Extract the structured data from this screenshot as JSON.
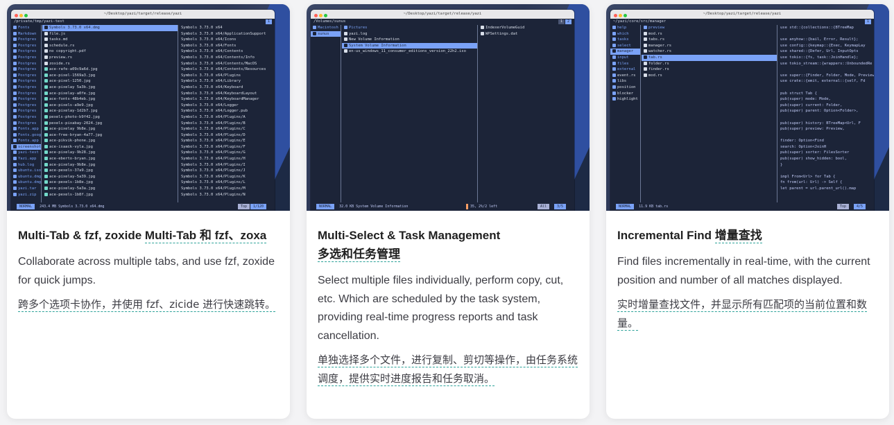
{
  "cards": [
    {
      "title": "Multi-Tab & fzf, zoxide",
      "title_cn": "Multi-Tab 和 fzf、zoxa",
      "description": "Collaborate across multiple tabs, and use fzf, zoxide for quick jumps.",
      "description_cn": "跨多个选项卡协作，并使用 fzf、zicide 进行快速跳转。",
      "terminal": {
        "window_title": "~/Desktop/yazi/target/release/yazi",
        "path": "/private/tmp/yazi-test",
        "tab_indicator": "1",
        "parent_rows": [
          "Fonts",
          "Markdown",
          "Postgres",
          "Postgres",
          "Postgres",
          "Postgres",
          "Postgres",
          "Postgres",
          "Postgres",
          "Postgres",
          "Postgres",
          "Postgres",
          "Postgres",
          "Postgres",
          "Postgres",
          "Postgres",
          "Postgres",
          "Fonts.app",
          "Fonts.goog",
          "Fonts.app",
          "screenshot",
          "yazi-test",
          "Yazi.app",
          "hub.log",
          "ubuntu.iso",
          "ubuntu.dmg",
          "ubuntu.dmg",
          "yazi.tar",
          "yazi.zip"
        ],
        "current_rows": [
          "Symbols 3.73.0 x64.dmg",
          "file.js",
          "tasks.md",
          "schedule.rs",
          "no copyright.pdf",
          "preview.rs",
          "zoxide.rs",
          "ace-rafe-a09c9a6d.jpg",
          "ace-pixel-1569a3.jpg",
          "ace-pixel-1250.jpg",
          "ace-pixelay 5a3b.jpg",
          "ace-pixelay-a0fe.jpg",
          "ace-fonts-48b4eb.jpg",
          "ace-pixels-a9e9.jpg",
          "ace-pixelay-1d2b7.jpg",
          "pexels-photo-b9f42.jpg",
          "pexels-pixabay-2024.jpg",
          "ace-pixelay 9b8e.jpg",
          "ace-free-bryan-4a77.jpg",
          "ace-pikvik-phone.jpg",
          "ace-isaack-vyla.jpg",
          "ace-pixelay-9b28.jpg",
          "ace-eberto-bryan.jpg",
          "ace-pixelay-9b8e.jpg",
          "ace-pexels-37a9.jpg",
          "ace-pixelay-5a39.jpg",
          "ace-pexels-1b8e.jpg",
          "ace-pixelay-5a3a.jpg",
          "ace-pexels-1b8f.jpg"
        ],
        "preview_rows": [
          "Symbols 3.73.0 x64",
          "Symbols 3.73.0 x64/ApplicationSupport",
          "Symbols 3.73.0 x64/Icons",
          "Symbols 3.73.0 x64/Fonts",
          "Symbols 3.73.0 x64/Contents",
          "Symbols 3.73.0 x64/Contents/Info",
          "Symbols 3.73.0 x64/Contents/MacOS",
          "Symbols 3.73.0 x64/Contents/Resources",
          "Symbols 3.73.0 x64/Plugins",
          "Symbols 3.73.0 x64/Library",
          "Symbols 3.73.0 x64/Keyboard",
          "Symbols 3.73.0 x64/KeyboardLayout",
          "Symbols 3.73.0 x64/KeyboardManager",
          "Symbols 3.73.0 x64/Logger",
          "Symbols 3.73.0 x64/Logger.pub",
          "Symbols 3.73.0 x64/Plugins/A",
          "Symbols 3.73.0 x64/Plugins/B",
          "Symbols 3.73.0 x64/Plugins/C",
          "Symbols 3.73.0 x64/Plugins/D",
          "Symbols 3.73.0 x64/Plugins/E",
          "Symbols 3.73.0 x64/Plugins/F",
          "Symbols 3.73.0 x64/Plugins/G",
          "Symbols 3.73.0 x64/Plugins/H",
          "Symbols 3.73.0 x64/Plugins/I",
          "Symbols 3.73.0 x64/Plugins/J",
          "Symbols 3.73.0 x64/Plugins/K",
          "Symbols 3.73.0 x64/Plugins/L",
          "Symbols 3.73.0 x64/Plugins/M",
          "Symbols 3.73.0 x64/Plugins/N"
        ],
        "status_mode": "NORMAL",
        "status_text": "243.4 MB   Symbols 3.73.0 x64.dmg",
        "status_right": "1/120",
        "status_mid": "Top"
      }
    },
    {
      "title": "Multi-Select & Task Management",
      "title_cn": "多选和任务管理",
      "description": "Select multiple files individually, perform copy, cut, etc. Which are scheduled by the task system, providing real-time progress reports and task cancellation.",
      "description_cn": "单独选择多个文件，进行复制、剪切等操作，由任务系统调度，提供实时进度报告和任务取消。",
      "terminal": {
        "window_title": "~/Desktop/yazi/target/release/yazi",
        "path": "/Volumes/sunus",
        "tab_indicator": "1",
        "tab_indicator_alt": "2",
        "parent_rows": [
          "Macintosh",
          "sunus"
        ],
        "current_rows": [
          "Pictures",
          "yazi.log",
          "New Volume Information",
          "System Volume Information",
          "en-us_windows_11_consumer_editions_version_22h2.iso"
        ],
        "preview_rows": [
          "IndexerVolumeGuid",
          "WPSettings.dat"
        ],
        "status_mode": "NORMAL",
        "status_text": "32.0 KB   System Volume Information",
        "status_right": "3/5",
        "status_mid": "All",
        "task_text": "35, 2%/2 left"
      }
    },
    {
      "title": "Incremental Find",
      "title_cn": "增量查找",
      "description": "Find files incrementally in real-time, with the current position and number of all matches displayed.",
      "description_cn": "实时增量查找文件，并显示所有匹配项的当前位置和数量。",
      "terminal": {
        "window_title": "~/Desktop/yazi/target/release/yazi",
        "path": "~/yazi/core/src/manager",
        "tab_indicator": "1",
        "parent_rows": [
          "help",
          "which",
          "tasks",
          "select",
          "manager",
          "input",
          "files",
          "external",
          "event.rs",
          "libs",
          "position",
          "blocker",
          "highlight"
        ],
        "current_rows": [
          "preview",
          "mod.rs",
          "tabs.rs",
          "manager.rs",
          "watcher.rs",
          "tab.rs",
          "folder.rs",
          "finder.rs",
          "mod.rs"
        ],
        "code_rows": [
          "use std::{collections::{BTreeMap",
          "",
          "use anyhow::{bail, Error, Result};",
          "use config::{keymap::{Exec, KeymapLay",
          "use shared::{Defer, Url, InputOpts",
          "use tokio::{fs, task::JoinHandle};",
          "use tokio_stream::{wrappers::UnboundedRe",
          "",
          "use super::{Finder, Folder, Mode, Preview",
          "use crate::{emit, external::{self, Fd",
          "",
          "pub struct Tab {",
          "  pub(super) mode:     Mode,",
          "  pub(super) current:  Folder,",
          "  pub(super) parent:   Option<Folder>,",
          "",
          "  pub(super) history:  BTreeMap<Url, F",
          "  pub(super) preview:  Preview,",
          "",
          "  finder:              Option<Find",
          "  search:              Option<JoinH",
          "  pub(super) sorter:   FilesSorter",
          "  pub(super) show_hidden: bool,",
          "}",
          "",
          "impl From<Url> for Tab {",
          "  fn from(url: Url) -> Self {",
          "    let parent = url.parent_url().map"
        ],
        "status_mode": "NORMAL",
        "status_text": "11.9 KB   tab.rs",
        "status_right": "4/5",
        "status_mid": "Top"
      }
    }
  ]
}
